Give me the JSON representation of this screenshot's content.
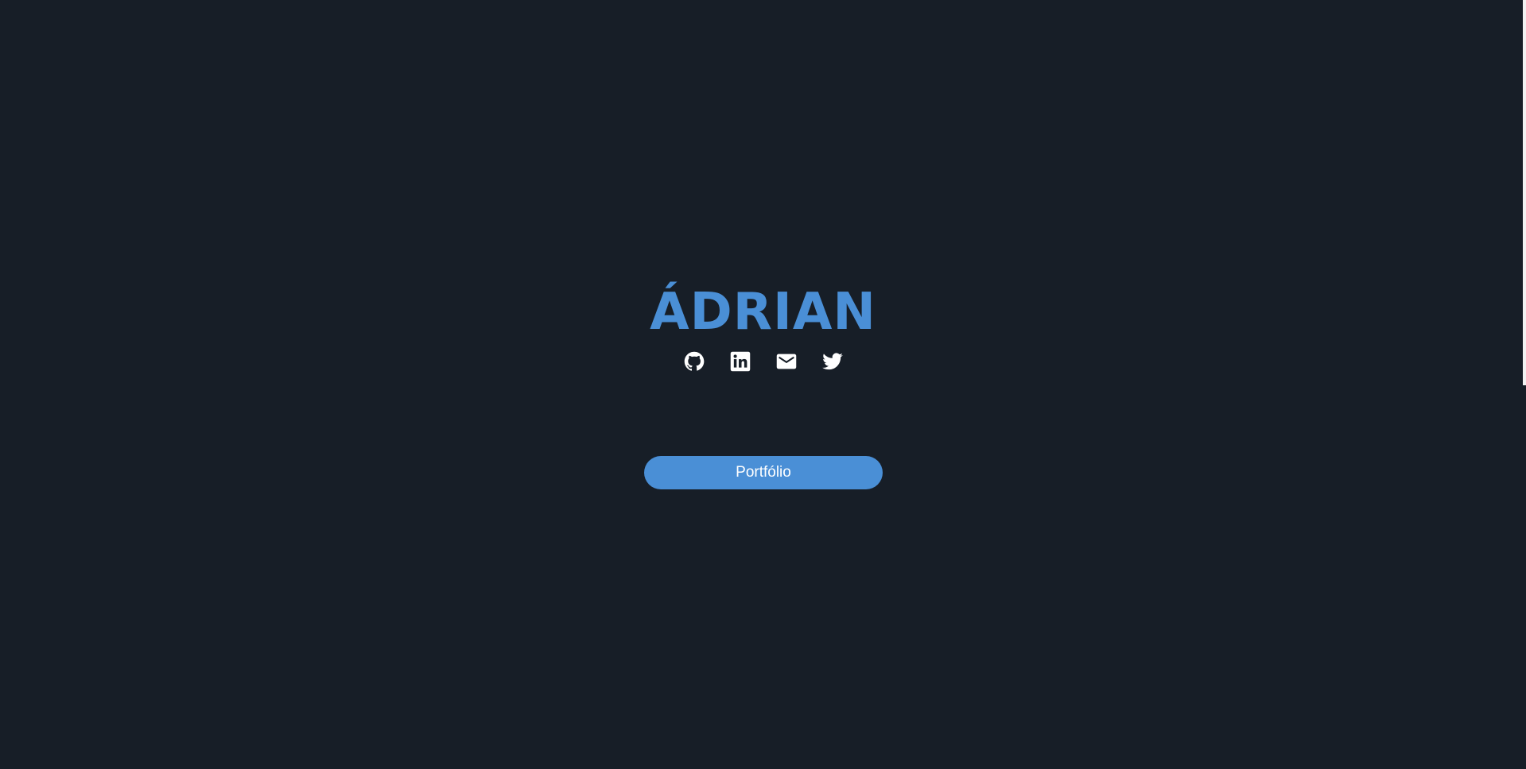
{
  "page": {
    "background": "#171e27",
    "accent": "#4a8fd6"
  },
  "hero": {
    "title": "ÁDRIAN"
  },
  "socials": [
    {
      "icon": "github-icon"
    },
    {
      "icon": "linkedin-icon"
    },
    {
      "icon": "email-icon"
    },
    {
      "icon": "twitter-icon"
    }
  ],
  "cta": {
    "label": "Portfólio"
  }
}
